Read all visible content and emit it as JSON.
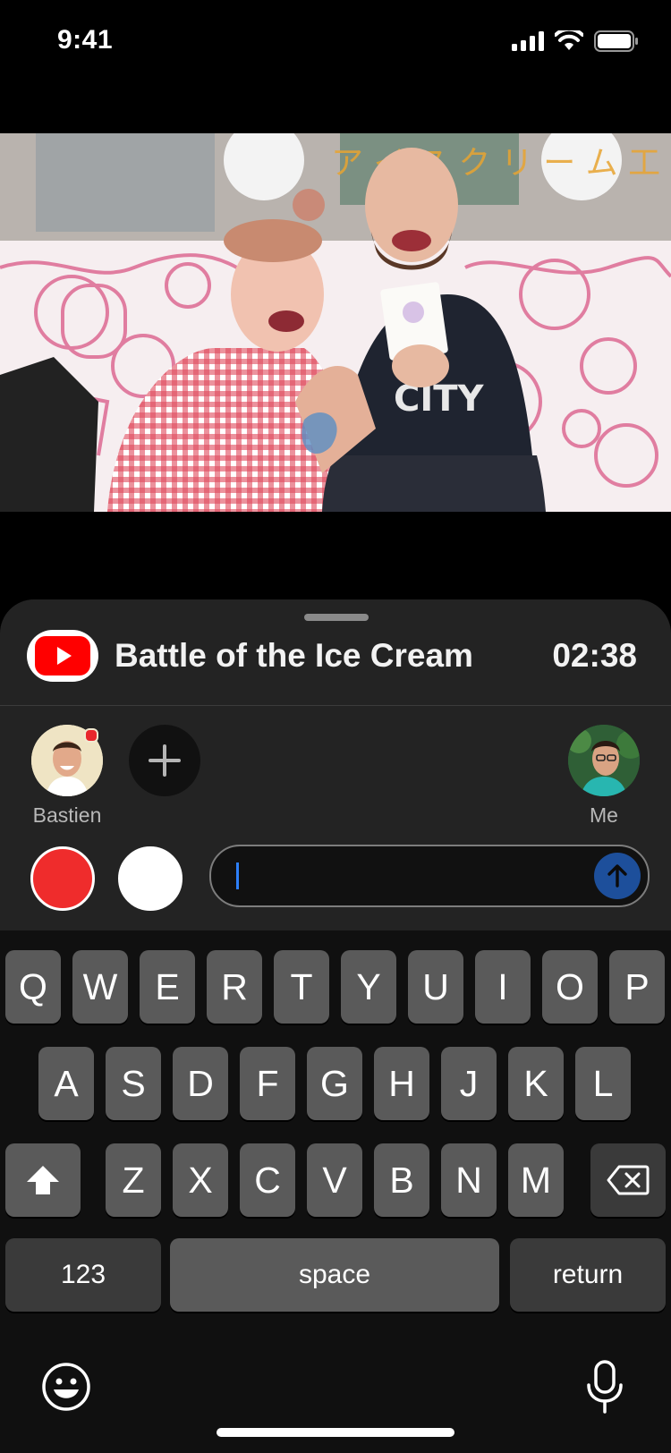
{
  "status_bar": {
    "time": "9:41"
  },
  "player": {
    "title": "Battle of the Ice Cream",
    "elapsed": "02:38",
    "brand_color": "#ff0000"
  },
  "participants": [
    {
      "name": "Bastien",
      "online": true
    },
    {
      "name": "Me"
    }
  ],
  "composer": {
    "value": "",
    "colors": [
      "#ef2c2c",
      "#ffffff"
    ]
  },
  "keyboard": {
    "row1": [
      "Q",
      "W",
      "E",
      "R",
      "T",
      "Y",
      "U",
      "I",
      "O",
      "P"
    ],
    "row2": [
      "A",
      "S",
      "D",
      "F",
      "G",
      "H",
      "J",
      "K",
      "L"
    ],
    "row3": [
      "Z",
      "X",
      "C",
      "V",
      "B",
      "N",
      "M"
    ],
    "numbers_label": "123",
    "space_label": "space",
    "return_label": "return"
  },
  "icons": [
    "signal-icon",
    "wifi-icon",
    "battery-icon",
    "youtube-icon",
    "plus-icon",
    "send-arrow-icon",
    "shift-icon",
    "backspace-icon",
    "emoji-icon",
    "microphone-icon"
  ]
}
